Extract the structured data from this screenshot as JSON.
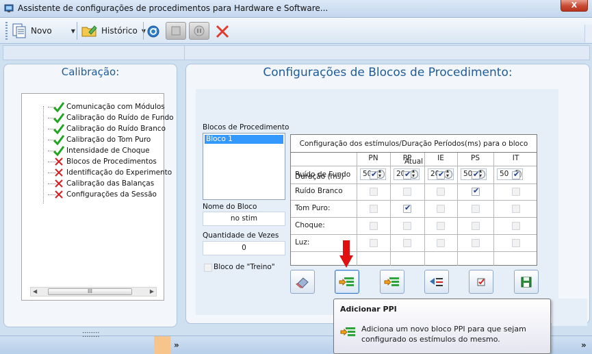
{
  "window": {
    "title": "Assistente de configurações de procedimentos para Hardware e Software...",
    "close_label": "X"
  },
  "toolbar": {
    "new_label": "Novo",
    "history_label": "Histórico"
  },
  "calibration": {
    "title": "Calibração:",
    "items": [
      {
        "label": "Comunicação com Módulos",
        "status": "done"
      },
      {
        "label": "Calibração do Ruído de Fundo",
        "status": "done"
      },
      {
        "label": "Calibração do Ruído Branco",
        "status": "done"
      },
      {
        "label": "Calibração do Tom Puro",
        "status": "done"
      },
      {
        "label": "Intensidade de Choque",
        "status": "done"
      },
      {
        "label": "Blocos de Procedimentos",
        "status": "pending"
      },
      {
        "label": "Identificação do Experimento",
        "status": "pending"
      },
      {
        "label": "Calibração das Balanças",
        "status": "pending"
      },
      {
        "label": "Configurações da Sessão",
        "status": "pending"
      }
    ],
    "scroll_thumb": "III"
  },
  "blocks": {
    "title": "Configurações de Blocos de Procedimento:",
    "list_label": "Blocos de Procedimento",
    "list_items": [
      "Bloco 1"
    ],
    "name_label": "Nome do Bloco",
    "name_value": "no stim",
    "count_label": "Quantidade de Vezes",
    "count_value": "0",
    "training_label": "Bloco de \"Treino\"",
    "training_checked": false
  },
  "grid": {
    "caption": "Configuração dos estímulos/Duração Períodos(ms) para o bloco Atual",
    "columns": [
      "PN",
      "PP",
      "IE",
      "PS",
      "IT"
    ],
    "duration_label": "Duração (ms)",
    "durations": [
      "50",
      "20",
      "20",
      "50",
      "50"
    ],
    "rows": [
      {
        "label": "Ruído de Fundo",
        "checks": [
          true,
          true,
          true,
          true,
          true
        ],
        "enabled": [
          true,
          true,
          true,
          true,
          true
        ]
      },
      {
        "label": "Ruído Branco",
        "checks": [
          false,
          false,
          false,
          true,
          false
        ],
        "enabled": [
          false,
          false,
          false,
          true,
          false
        ]
      },
      {
        "label": "Tom Puro:",
        "checks": [
          false,
          true,
          false,
          false,
          false
        ],
        "enabled": [
          false,
          true,
          false,
          false,
          false
        ]
      },
      {
        "label": "Choque:",
        "checks": [
          false,
          false,
          false,
          false,
          false
        ],
        "enabled": [
          false,
          false,
          false,
          false,
          false
        ]
      },
      {
        "label": "Luz:",
        "checks": [
          false,
          false,
          false,
          false,
          false
        ],
        "enabled": [
          false,
          false,
          false,
          false,
          false
        ]
      }
    ]
  },
  "tooltip": {
    "title": "Adicionar PPI",
    "body": "Adiciona um novo bloco PPI para que sejam configurado os estímulos do mesmo."
  },
  "colors": {
    "accent": "#1f5b99",
    "check_green": "#1fa51f",
    "cross_red": "#d42020",
    "arrow_red": "#e01010"
  }
}
